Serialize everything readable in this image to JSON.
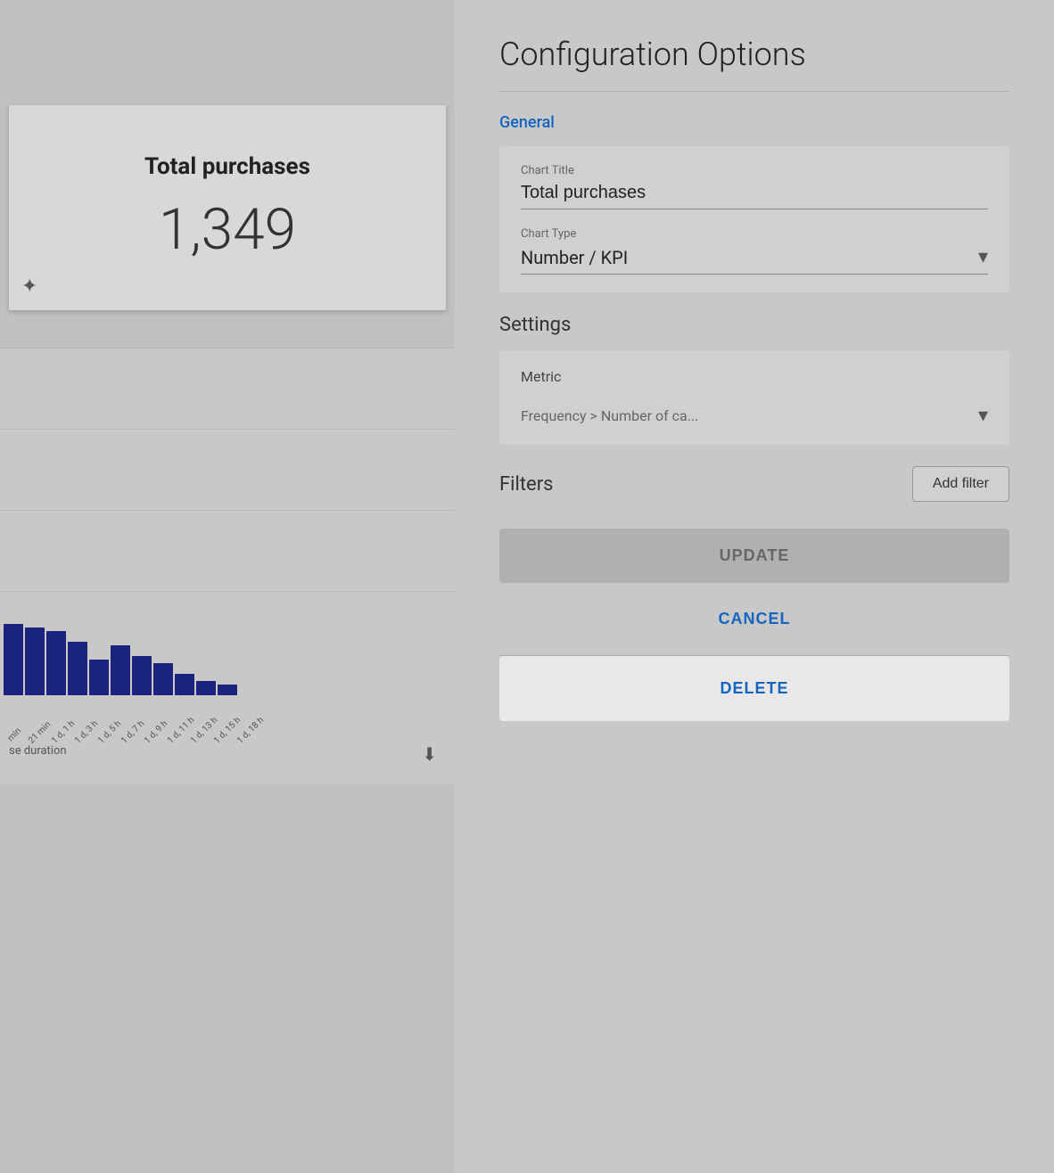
{
  "left": {
    "kpi": {
      "title": "Total purchases",
      "value": "1,349"
    },
    "chart": {
      "footer_label": "se duration",
      "x_labels": [
        "min",
        "21 min",
        "1 d, 1 h",
        "1 d, 3 h",
        "1 d, 5 h",
        "1 d, 7 h",
        "1 d, 9 h",
        "1 d, 11 h",
        "1 d, 13 h",
        "1 d, 15 h",
        "1 d, 18 h"
      ],
      "bars": [
        40,
        38,
        36,
        30,
        20,
        28,
        22,
        18,
        12,
        8,
        6
      ],
      "download_icon": "⬇"
    },
    "move_icon": "⬡"
  },
  "right": {
    "title": "Configuration Options",
    "general_label": "General",
    "general_card": {
      "chart_title_label": "Chart Title",
      "chart_title_value": "Total purchases",
      "chart_type_label": "Chart Type",
      "chart_type_value": "Number / KPI"
    },
    "settings_label": "Settings",
    "settings_card": {
      "metric_label": "Metric",
      "metric_value": "Frequency > Number of ca..."
    },
    "filters_label": "Filters",
    "add_filter_label": "Add filter",
    "update_label": "UPDATE",
    "cancel_label": "CANCEL",
    "delete_label": "DELETE"
  }
}
